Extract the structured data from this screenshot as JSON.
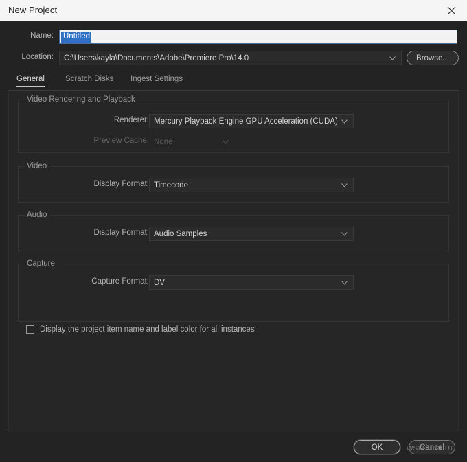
{
  "window": {
    "title": "New Project",
    "close_icon": "close-icon"
  },
  "name_row": {
    "label": "Name:",
    "value": "Untitled",
    "selected": true,
    "selection_color": "#2f6fc4"
  },
  "location_row": {
    "label": "Location:",
    "value": "C:\\Users\\kayla\\Documents\\Adobe\\Premiere Pro\\14.0",
    "browse_label": "Browse...",
    "caret_icon": "chevron-down-icon"
  },
  "tabs": [
    {
      "label": "General",
      "active": true
    },
    {
      "label": "Scratch Disks",
      "active": false
    },
    {
      "label": "Ingest Settings",
      "active": false
    }
  ],
  "groups": {
    "rendering": {
      "title": "Video Rendering and Playback",
      "fields": [
        {
          "label": "Renderer:",
          "value": "Mercury Playback Engine GPU Acceleration (CUDA)",
          "disabled": false
        },
        {
          "label": "Preview Cache:",
          "value": "None",
          "disabled": true
        }
      ]
    },
    "video": {
      "title": "Video",
      "fields": [
        {
          "label": "Display Format:",
          "value": "Timecode",
          "disabled": false
        }
      ]
    },
    "audio": {
      "title": "Audio",
      "fields": [
        {
          "label": "Display Format:",
          "value": "Audio Samples",
          "disabled": false
        }
      ]
    },
    "capture": {
      "title": "Capture",
      "fields": [
        {
          "label": "Capture Format:",
          "value": "DV",
          "disabled": false
        }
      ]
    }
  },
  "checkbox": {
    "label": "Display the project item name and label color for all instances",
    "checked": false
  },
  "footer": {
    "ok_label": "OK",
    "cancel_label": "Cancel"
  },
  "watermark": {
    "text": "wsxdn.com"
  }
}
